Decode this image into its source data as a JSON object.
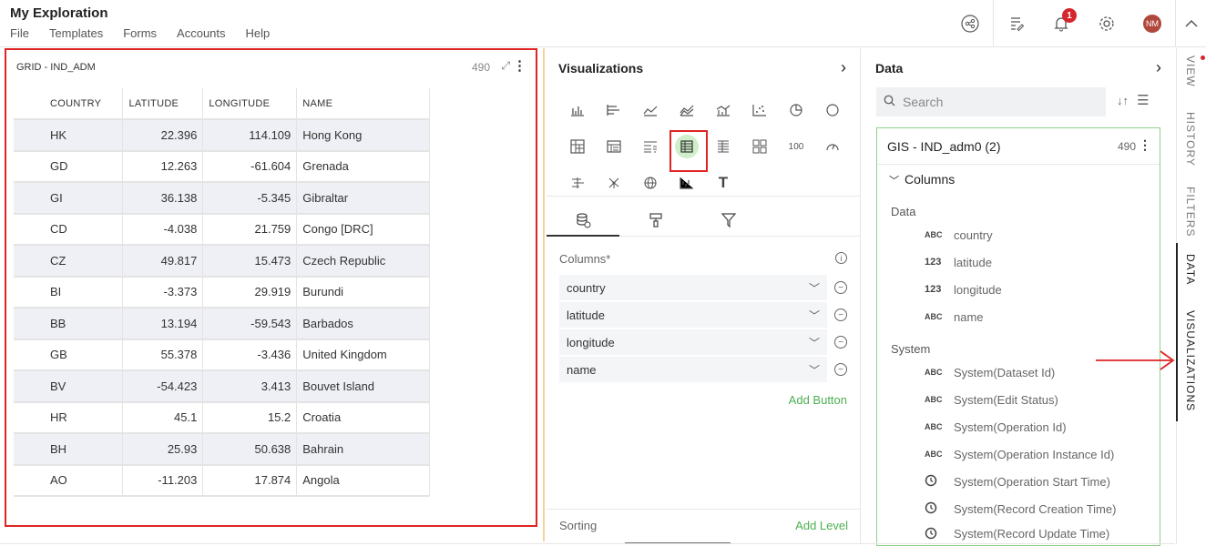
{
  "app": {
    "title": "My Exploration",
    "menu": [
      "File",
      "Templates",
      "Forms",
      "Accounts",
      "Help"
    ],
    "notification_count": "1",
    "avatar_initials": "NM"
  },
  "grid": {
    "title": "GRID - IND_ADM",
    "count": "490",
    "headers": [
      "COUNTRY",
      "LATITUDE",
      "LONGITUDE",
      "NAME"
    ],
    "rows": [
      [
        "HK",
        "22.396",
        "114.109",
        "Hong Kong"
      ],
      [
        "GD",
        "12.263",
        "-61.604",
        "Grenada"
      ],
      [
        "GI",
        "36.138",
        "-5.345",
        "Gibraltar"
      ],
      [
        "CD",
        "-4.038",
        "21.759",
        "Congo [DRC]"
      ],
      [
        "CZ",
        "49.817",
        "15.473",
        "Czech Republic"
      ],
      [
        "BI",
        "-3.373",
        "29.919",
        "Burundi"
      ],
      [
        "BB",
        "13.194",
        "-59.543",
        "Barbados"
      ],
      [
        "GB",
        "55.378",
        "-3.436",
        "United Kingdom"
      ],
      [
        "BV",
        "-54.423",
        "3.413",
        "Bouvet Island"
      ],
      [
        "HR",
        "45.1",
        "15.2",
        "Croatia"
      ],
      [
        "BH",
        "25.93",
        "50.638",
        "Bahrain"
      ],
      [
        "AO",
        "-11.203",
        "17.874",
        "Angola"
      ]
    ]
  },
  "visualizations": {
    "title": "Visualizations",
    "selected_icon": "table-icon",
    "number_icon_label": "100",
    "text_icon_label": "T",
    "columns_label": "Columns*",
    "columns": [
      "country",
      "latitude",
      "longitude",
      "name"
    ],
    "add_button": "Add Button",
    "sorting_label": "Sorting",
    "add_level": "Add Level"
  },
  "data": {
    "title": "Data",
    "search_placeholder": "Search",
    "dataset_name": "GIS - IND_adm0 (2)",
    "dataset_count": "490",
    "columns_toggle": "Columns",
    "data_group": "Data",
    "data_fields": [
      {
        "type": "ABC",
        "name": "country"
      },
      {
        "type": "123",
        "name": "latitude"
      },
      {
        "type": "123",
        "name": "longitude"
      },
      {
        "type": "ABC",
        "name": "name"
      }
    ],
    "system_group": "System",
    "system_fields": [
      {
        "type": "ABC",
        "name": "System(Dataset Id)"
      },
      {
        "type": "ABC",
        "name": "System(Edit Status)"
      },
      {
        "type": "ABC",
        "name": "System(Operation Id)"
      },
      {
        "type": "ABC",
        "name": "System(Operation Instance Id)"
      },
      {
        "type": "clock",
        "name": "System(Operation Start Time)"
      },
      {
        "type": "clock",
        "name": "System(Record Creation Time)"
      },
      {
        "type": "clock",
        "name": "System(Record Update Time)"
      }
    ]
  },
  "side_tabs": [
    "VIEW",
    "HISTORY",
    "FILTERS",
    "DATA",
    "VISUALIZATIONS"
  ],
  "colors": {
    "highlight_red": "#e02424",
    "accent_green": "#4caf50",
    "selected_viz_bg": "#cfeec9"
  }
}
